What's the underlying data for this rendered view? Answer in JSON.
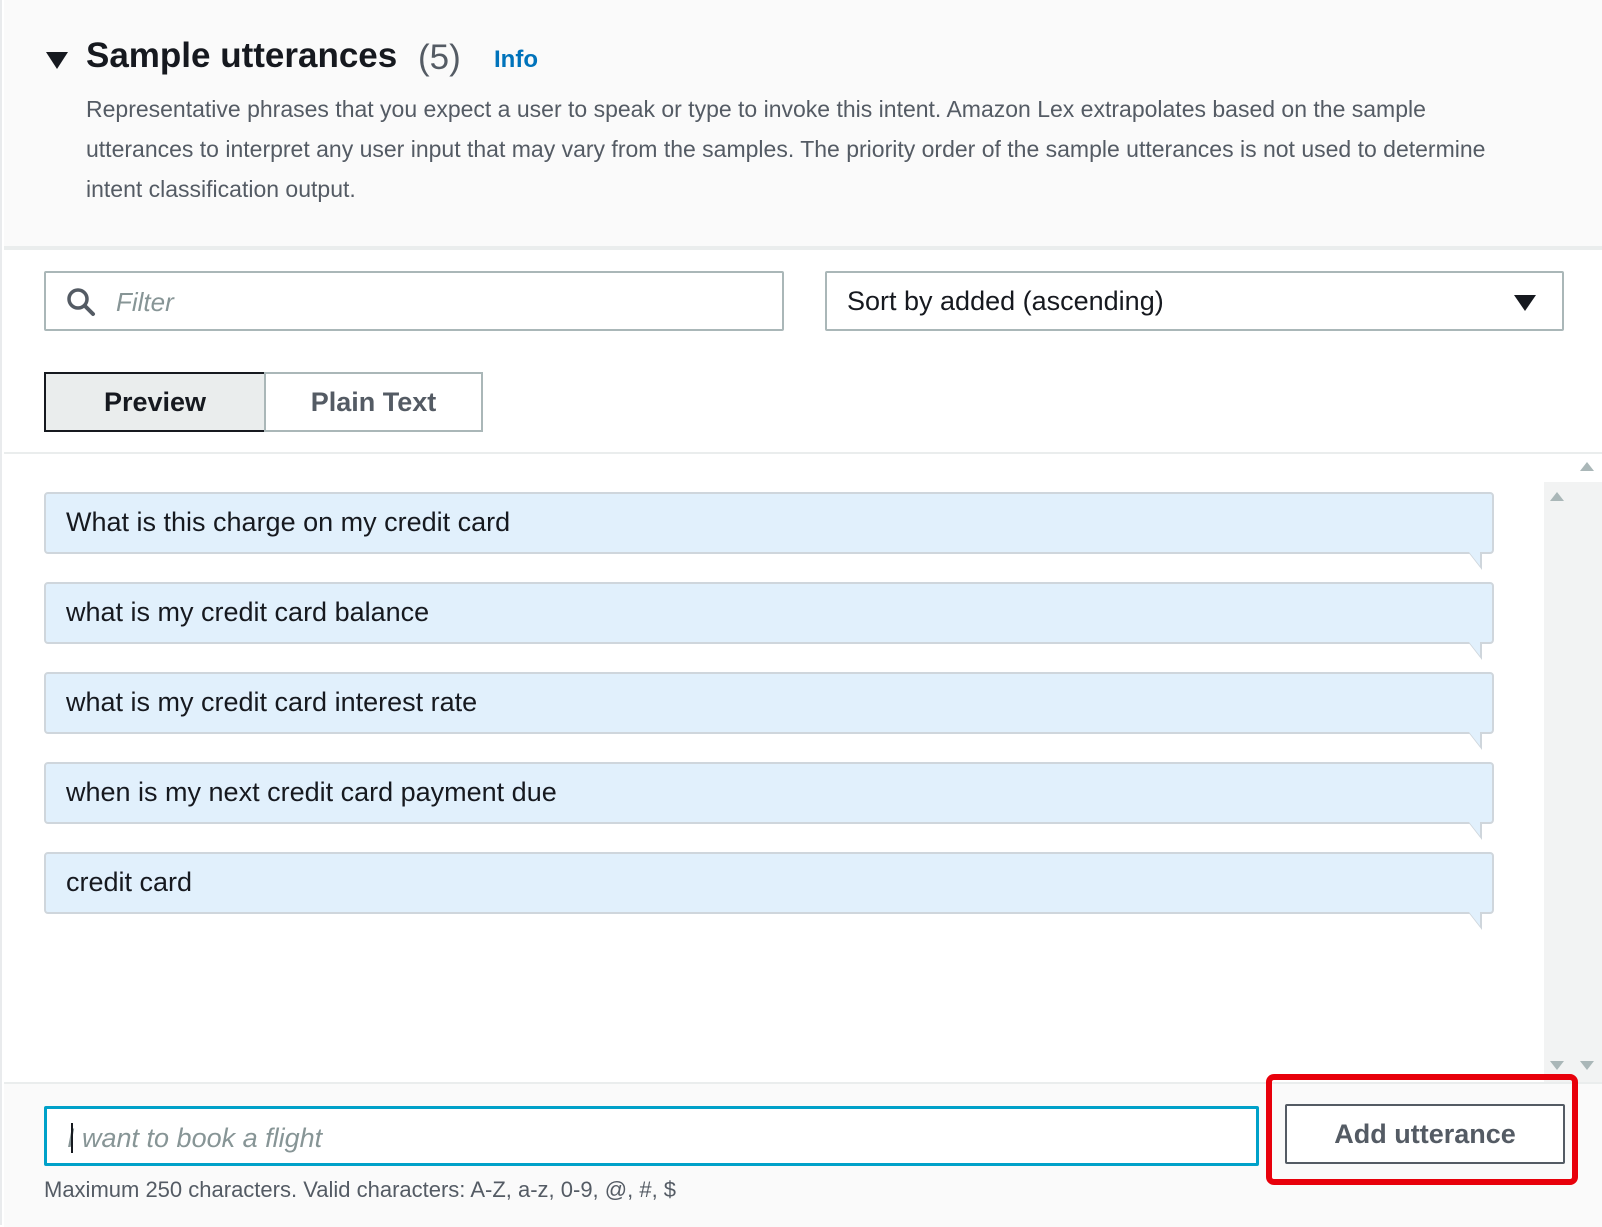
{
  "section": {
    "title": "Sample utterances",
    "count": "(5)",
    "info_label": "Info",
    "description": "Representative phrases that you expect a user to speak or type to invoke this intent. Amazon Lex extrapolates based on the sample utterances to interpret any user input that may vary from the samples. The priority order of the sample utterances is not used to determine intent classification output."
  },
  "filter": {
    "placeholder": "Filter",
    "value": ""
  },
  "sort": {
    "selected": "Sort by added (ascending)"
  },
  "view_tabs": [
    {
      "label": "Preview",
      "active": true
    },
    {
      "label": "Plain Text",
      "active": false
    }
  ],
  "utterances": [
    "What is this charge on my credit card",
    "what is my credit card balance",
    "what is my credit card interest rate",
    "when is my next credit card payment due",
    "credit card"
  ],
  "add": {
    "placeholder": "I want to book a flight",
    "value": "",
    "button_label": "Add utterance",
    "constraint": "Maximum 250 characters. Valid characters: A-Z, a-z, 0-9, @, #, $"
  },
  "colors": {
    "accent": "#0073bb",
    "focus": "#00a1c9",
    "bubble": "#e1f0fc",
    "highlight": "#e8000b"
  },
  "icons": [
    "caret-down-icon",
    "search-icon",
    "dropdown-arrow-icon",
    "scroll-up-icon",
    "scroll-down-icon"
  ]
}
